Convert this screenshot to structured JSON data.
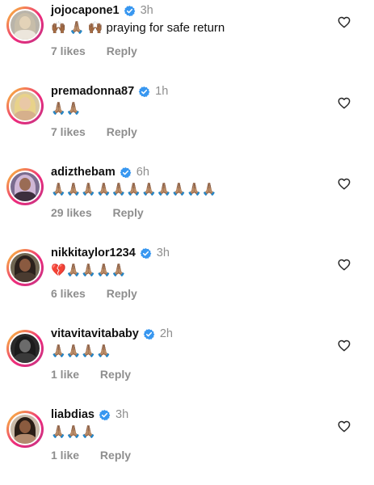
{
  "comments": [
    {
      "username": "jojocapone1",
      "time": "3h",
      "text": "🙌🏾 🙏🏽 🙌🏾 praying for safe return",
      "likes": "7 likes",
      "reply": "Reply",
      "avatar_colors": {
        "bg": "#b9b4aa",
        "hair": "#c7bda9",
        "face": "#e3d3b8",
        "body": "#ece6dc"
      }
    },
    {
      "username": "premadonna87",
      "time": "1h",
      "text": "🙏🏽🙏🏽",
      "likes": "7 likes",
      "reply": "Reply",
      "avatar_colors": {
        "bg": "#d7c7a3",
        "hair": "#e8d28a",
        "face": "#e9c8a6",
        "body": "#d6b08c"
      }
    },
    {
      "username": "adizthebam",
      "time": "6h",
      "text": "🙏🏽🙏🏽🙏🏽🙏🏽🙏🏽🙏🏽🙏🏽🙏🏽🙏🏽🙏🏽🙏🏽",
      "likes": "29 likes",
      "reply": "Reply",
      "avatar_colors": {
        "bg": "#7a6c8f",
        "hair": "#cfb7d6",
        "face": "#9a6c55",
        "body": "#3d2f3e"
      }
    },
    {
      "username": "nikkitaylor1234",
      "time": "3h",
      "text": "💔🙏🏽🙏🏽🙏🏽🙏🏽",
      "likes": "6 likes",
      "reply": "Reply",
      "avatar_colors": {
        "bg": "#6f6652",
        "hair": "#2b211c",
        "face": "#8a5a40",
        "body": "#4a3b30"
      }
    },
    {
      "username": "vitavitavitababy",
      "time": "2h",
      "text": "🙏🏽🙏🏽🙏🏽🙏🏽",
      "likes": "1 like",
      "reply": "Reply",
      "avatar_colors": {
        "bg": "#2a2a2a",
        "hair": "#1b1b1b",
        "face": "#6b6b6b",
        "body": "#3a3a3a"
      }
    },
    {
      "username": "liabdias",
      "time": "3h",
      "text": "🙏🏽🙏🏽🙏🏽",
      "likes": "1 like",
      "reply": "Reply",
      "avatar_colors": {
        "bg": "#c9b9a8",
        "hair": "#2a1d16",
        "face": "#8b5b3f",
        "body": "#b28a6e"
      }
    }
  ],
  "icons": {
    "verified": "verified-badge-icon",
    "like": "heart-outline-icon"
  },
  "colors": {
    "verified_blue": "#3897f0",
    "secondary_text": "#8e8e8e",
    "story_ring_start": "#f9ce34",
    "story_ring_end": "#c13584"
  }
}
